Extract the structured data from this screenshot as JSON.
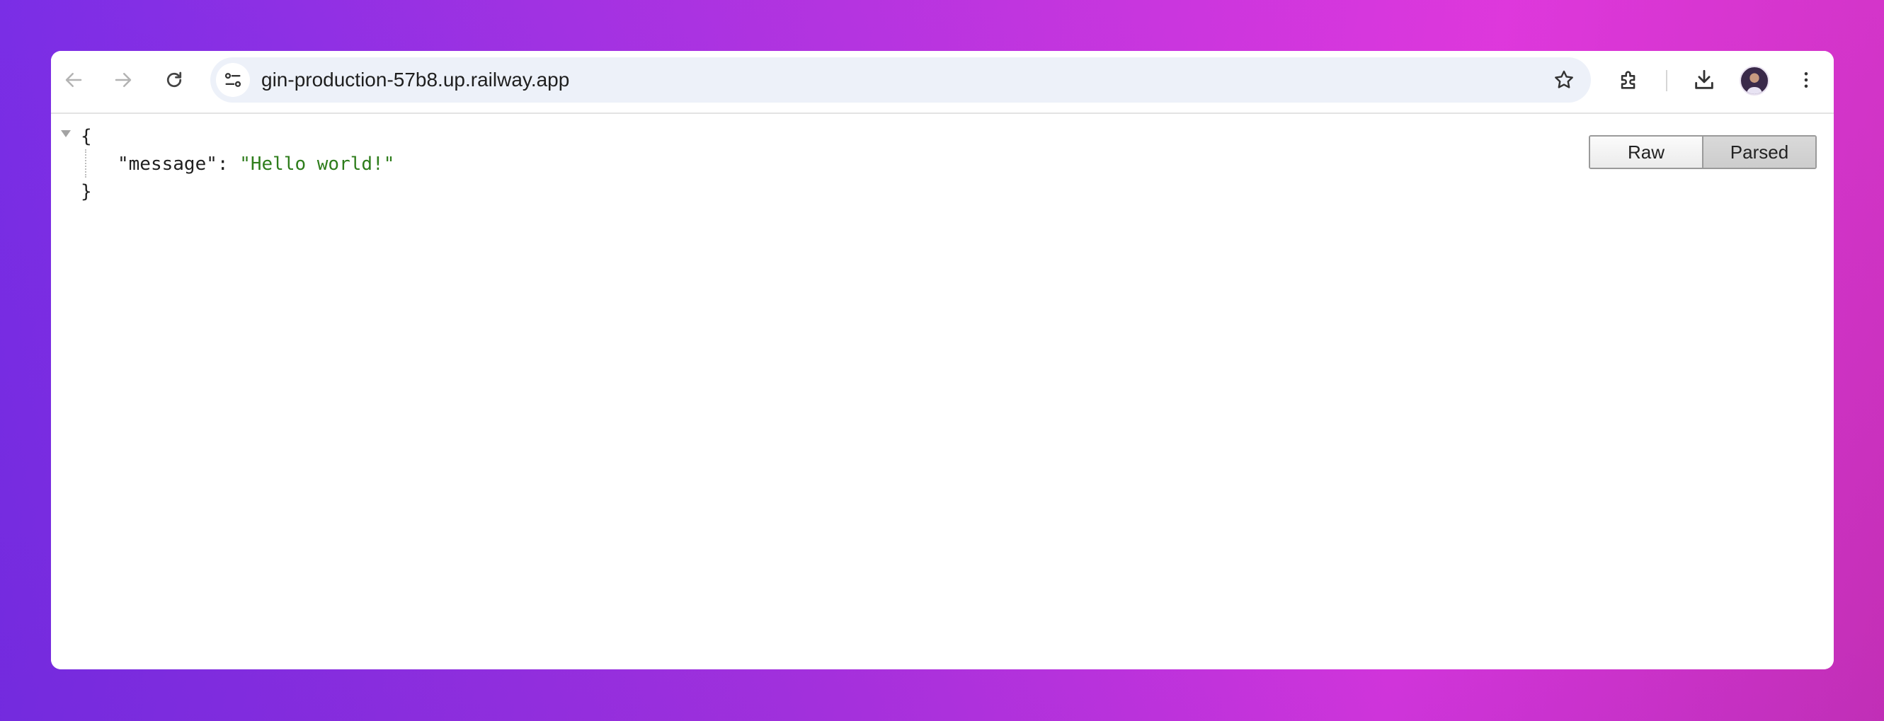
{
  "browser": {
    "url": "gin-production-57b8.up.railway.app",
    "toolbar_icons": [
      "back-arrow-icon",
      "forward-arrow-icon",
      "reload-icon",
      "site-info-icon",
      "star-icon",
      "extensions-icon",
      "download-icon",
      "avatar",
      "more-vert-icon"
    ]
  },
  "json_viewer": {
    "open_brace": "{",
    "close_brace": "}",
    "key": "\"message\"",
    "separator": ": ",
    "value": "\"Hello world!\"",
    "string_color": "#2e7d1b"
  },
  "view_toggle": {
    "raw_label": "Raw",
    "parsed_label": "Parsed",
    "selected": "Parsed"
  }
}
